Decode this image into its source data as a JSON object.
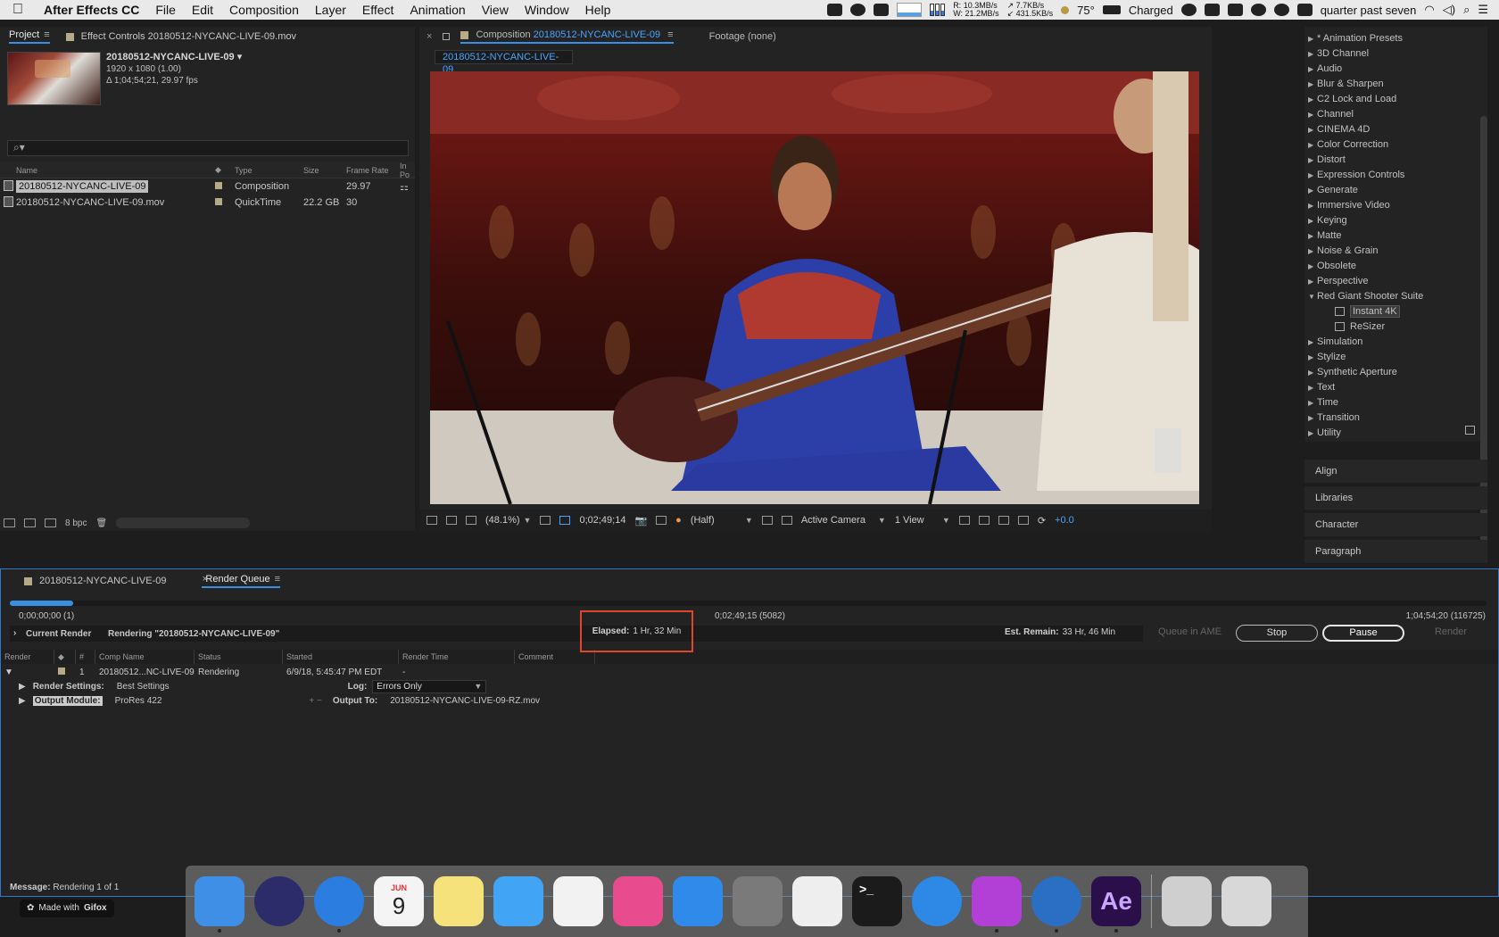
{
  "menubar": {
    "apple": "",
    "app_name": "After Effects CC",
    "menus": [
      "File",
      "Edit",
      "Composition",
      "Layer",
      "Effect",
      "Animation",
      "View",
      "Window",
      "Help"
    ],
    "net": {
      "r_label": "R:",
      "w_label": "W:",
      "r_val": "10.3MB/s",
      "w_val": "21.2MB/s"
    },
    "net2": {
      "up": "7.7KB/s",
      "down": "431.5KB/s"
    },
    "temp": "75°",
    "battery": "Charged",
    "clock": "quarter past seven"
  },
  "project": {
    "tab_project": "Project",
    "tab_effect_controls": "Effect Controls 20180512-NYCANC-LIVE-09.mov",
    "selected_name": "20180512-NYCANC-LIVE-09 ▾",
    "dims": "1920 x 1080 (1.00)",
    "duration": "Δ 1;04;54;21, 29.97 fps",
    "search_placeholder": "⌕▾",
    "columns": [
      "Name",
      "Type",
      "Size",
      "Frame Rate",
      "In Po"
    ],
    "rows": [
      {
        "name": "20180512-NYCANC-LIVE-09",
        "type": "Composition",
        "size": "",
        "fps": "29.97"
      },
      {
        "name": "20180512-NYCANC-LIVE-09.mov",
        "type": "QuickTime",
        "size": "22.2 GB",
        "fps": "30"
      }
    ],
    "bpc": "8 bpc"
  },
  "comp": {
    "tab_prefix": "Composition",
    "tab_name": "20180512-NYCANC-LIVE-09",
    "footage": "Footage (none)",
    "sub_tab": "20180512-NYCANC-LIVE-09",
    "zoom": "(48.1%)",
    "timecode": "0;02;49;14",
    "resolution": "(Half)",
    "camera": "Active Camera",
    "views": "1 View",
    "exposure": "+0.0"
  },
  "effects": {
    "items": [
      {
        "label": "* Animation Presets",
        "open": false
      },
      {
        "label": "3D Channel",
        "open": false
      },
      {
        "label": "Audio",
        "open": false
      },
      {
        "label": "Blur & Sharpen",
        "open": false
      },
      {
        "label": "C2 Lock and Load",
        "open": false
      },
      {
        "label": "Channel",
        "open": false
      },
      {
        "label": "CINEMA 4D",
        "open": false
      },
      {
        "label": "Color Correction",
        "open": false
      },
      {
        "label": "Distort",
        "open": false
      },
      {
        "label": "Expression Controls",
        "open": false
      },
      {
        "label": "Generate",
        "open": false
      },
      {
        "label": "Immersive Video",
        "open": false
      },
      {
        "label": "Keying",
        "open": false
      },
      {
        "label": "Matte",
        "open": false
      },
      {
        "label": "Noise & Grain",
        "open": false
      },
      {
        "label": "Obsolete",
        "open": false
      },
      {
        "label": "Perspective",
        "open": false
      },
      {
        "label": "Red Giant Shooter Suite",
        "open": true
      },
      {
        "label": "Instant 4K",
        "sub": true,
        "highlight": true
      },
      {
        "label": "ReSizer",
        "sub": true
      },
      {
        "label": "Simulation",
        "open": false
      },
      {
        "label": "Stylize",
        "open": false
      },
      {
        "label": "Synthetic Aperture",
        "open": false
      },
      {
        "label": "Text",
        "open": false
      },
      {
        "label": "Time",
        "open": false
      },
      {
        "label": "Transition",
        "open": false
      },
      {
        "label": "Utility",
        "open": false
      }
    ],
    "side_panels": [
      "Align",
      "Libraries",
      "Character",
      "Paragraph"
    ]
  },
  "render_queue": {
    "tab_comp": "20180512-NYCANC-LIVE-09",
    "tab_rq": "Render Queue",
    "progress": 0.043,
    "tc_start": "0;00;00;00 (1)",
    "tc_current": "0;02;49;15 (5082)",
    "tc_end": "1;04;54;20 (116725)",
    "current_render_label": "Current Render",
    "rendering_text": "Rendering \"20180512-NYCANC-LIVE-09\"",
    "elapsed_label": "Elapsed:",
    "elapsed_value": "1 Hr, 32 Min",
    "remain_label": "Est. Remain:",
    "remain_value": "33 Hr, 46 Min",
    "btn_queue_ame": "Queue in AME",
    "btn_stop": "Stop",
    "btn_pause": "Pause",
    "btn_render": "Render",
    "columns": [
      "Render",
      "#",
      "Comp Name",
      "Status",
      "Started",
      "Render Time",
      "Comment"
    ],
    "item": {
      "num": "1",
      "comp": "20180512...NC-LIVE-09",
      "status": "Rendering",
      "started": "6/9/18, 5:45:47 PM EDT",
      "render_time": "-"
    },
    "render_settings_label": "Render Settings:",
    "render_settings_value": "Best Settings",
    "log_label": "Log:",
    "log_value": "Errors Only",
    "output_module_label": "Output Module:",
    "output_module_value": "ProRes 422",
    "output_to_label": "Output To:",
    "output_to_value": "20180512-NYCANC-LIVE-09-RZ.mov",
    "message_label": "Message:",
    "message_value": "Rendering 1 of 1"
  },
  "gifox": {
    "prefix": "Made with",
    "brand": "Gifox"
  },
  "dock": {
    "apps": [
      {
        "name": "finder",
        "color": "#3f8fe6"
      },
      {
        "name": "siri",
        "color": "#2c2c6a"
      },
      {
        "name": "safari",
        "color": "#2b7de0"
      },
      {
        "name": "calendar",
        "color": "#f4f4f4",
        "month": "JUN",
        "day": "9"
      },
      {
        "name": "notes",
        "color": "#f6e27a"
      },
      {
        "name": "messages",
        "color": "#41a4f5"
      },
      {
        "name": "photos",
        "color": "#f2f2f2"
      },
      {
        "name": "itunes",
        "color": "#e94c8e"
      },
      {
        "name": "app-store",
        "color": "#2f8ae9"
      },
      {
        "name": "system-preferences",
        "color": "#7a7a7a"
      },
      {
        "name": "textedit",
        "color": "#eeeeee"
      },
      {
        "name": "terminal",
        "color": "#1b1b1b",
        "glyph": ">_"
      },
      {
        "name": "quicktime",
        "color": "#2e88e6"
      },
      {
        "name": "flower-app",
        "color": "#b23fd6"
      },
      {
        "name": "1password",
        "color": "#2b6fc5"
      },
      {
        "name": "after-effects",
        "color": "#2a0f4a",
        "glyph": "Ae"
      },
      {
        "name": "finder-doc",
        "color": "#cfcfcf"
      },
      {
        "name": "trash",
        "color": "#d8d8d8"
      }
    ]
  }
}
